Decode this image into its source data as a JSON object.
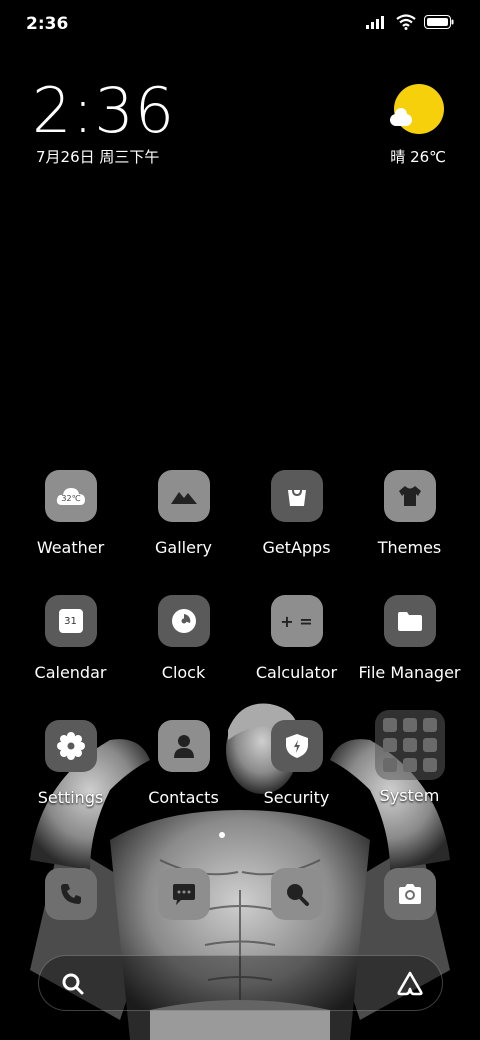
{
  "status_bar": {
    "time": "2:36",
    "icons": [
      "signal-icon",
      "wifi-icon",
      "battery-icon"
    ]
  },
  "clock_widget": {
    "time": "2:36",
    "date": "7月26日 周三下午"
  },
  "weather_widget": {
    "text": "晴 26℃",
    "sun_color": "#f7d00c"
  },
  "apps": {
    "weather": {
      "label": "Weather",
      "icon_text": "32℃"
    },
    "gallery": {
      "label": "Gallery"
    },
    "getapps": {
      "label": "GetApps"
    },
    "themes": {
      "label": "Themes"
    },
    "calendar": {
      "label": "Calendar",
      "icon_text": "31"
    },
    "clock": {
      "label": "Clock"
    },
    "calculator": {
      "label": "Calculator",
      "icon_text": "+ ="
    },
    "file_manager": {
      "label": "File Manager"
    },
    "settings": {
      "label": "Settings"
    },
    "contacts": {
      "label": "Contacts"
    },
    "security": {
      "label": "Security"
    },
    "system": {
      "label": "System"
    }
  },
  "dock": {
    "items": [
      "phone-icon",
      "messages-icon",
      "browser-icon",
      "camera-icon"
    ]
  },
  "search_bar": {
    "icons": [
      "search-icon",
      "assistant-icon"
    ]
  }
}
